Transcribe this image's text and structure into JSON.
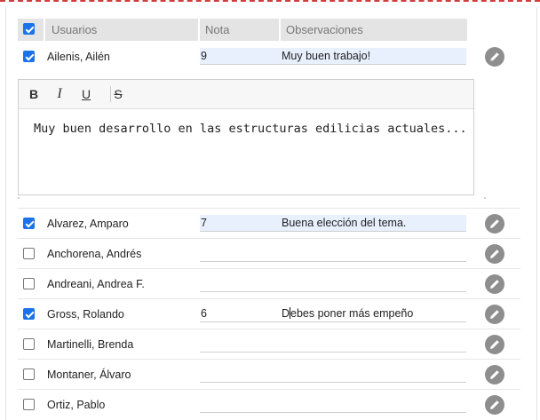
{
  "table": {
    "header": {
      "select_all_checked": true,
      "col_users": "Usuarios",
      "col_grade": "Nota",
      "col_notes": "Observaciones"
    },
    "rows": [
      {
        "name": "Ailenis, Ailén",
        "checked": true,
        "grade": "9",
        "notes": "Muy buen trabajo!"
      },
      {
        "name": "Alvarez, Amparo",
        "checked": true,
        "grade": "7",
        "notes": "Buena elección del tema."
      },
      {
        "name": "Anchorena, Andrés",
        "checked": false,
        "grade": "",
        "notes": ""
      },
      {
        "name": "Andreani, Andrea F.",
        "checked": false,
        "grade": "",
        "notes": ""
      },
      {
        "name": "Gross, Rolando",
        "checked": true,
        "grade": "6",
        "notes_before_caret": "D",
        "notes_after_caret": "ebes poner más empeño"
      },
      {
        "name": "Martinelli, Brenda",
        "checked": false,
        "grade": "",
        "notes": ""
      },
      {
        "name": "Montaner, Álvaro",
        "checked": false,
        "grade": "",
        "notes": ""
      },
      {
        "name": "Ortiz, Pablo",
        "checked": false,
        "grade": "",
        "notes": ""
      }
    ]
  },
  "editor": {
    "toolbar": {
      "bold": "B",
      "italic": "I",
      "underline": "U",
      "strike": "S"
    },
    "content": "Muy buen desarrollo en las estructuras edilicias actuales..."
  },
  "icons": {
    "edit": "pencil-icon",
    "edit_color": "#8e8e8e",
    "check_color": "#1a73e8"
  }
}
